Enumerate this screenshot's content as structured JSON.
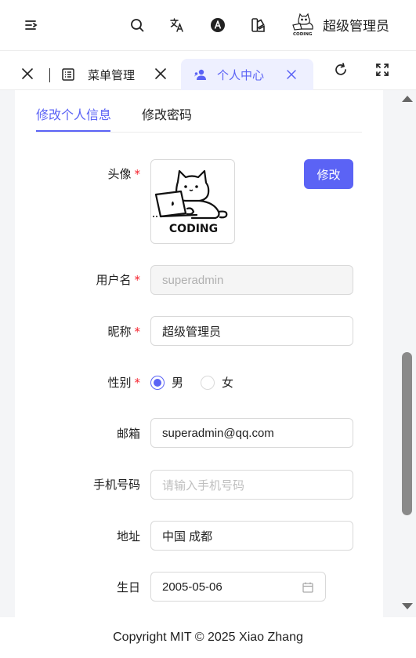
{
  "header": {
    "username": "超级管理员",
    "icons": [
      "menu-fold-icon",
      "search-icon",
      "translate-icon",
      "theme-a-icon",
      "palette-icon"
    ]
  },
  "tabs": [
    {
      "label": "菜单管理",
      "icon": "list-icon",
      "active": false
    },
    {
      "label": "个人中心",
      "icon": "user-group-icon",
      "active": true
    }
  ],
  "form_tabs": {
    "active": "修改个人信息",
    "inactive": "修改密码"
  },
  "form": {
    "avatar_label": "头像",
    "avatar_text": "CODING",
    "edit_button": "修改",
    "username_label": "用户名",
    "username_value": "superadmin",
    "nickname_label": "昵称",
    "nickname_value": "超级管理员",
    "gender_label": "性别",
    "gender_options": [
      "男",
      "女"
    ],
    "gender_selected": "男",
    "email_label": "邮箱",
    "email_value": "superadmin@qq.com",
    "phone_label": "手机号码",
    "phone_placeholder": "请输入手机号码",
    "address_label": "地址",
    "address_value": "中国 成都",
    "birthday_label": "生日",
    "birthday_value": "2005-05-06",
    "required_mark": "*"
  },
  "footer": {
    "text": "Copyright MIT © 2025 Xiao Zhang"
  },
  "colors": {
    "primary": "#5b63f5",
    "required": "#f5222d"
  }
}
